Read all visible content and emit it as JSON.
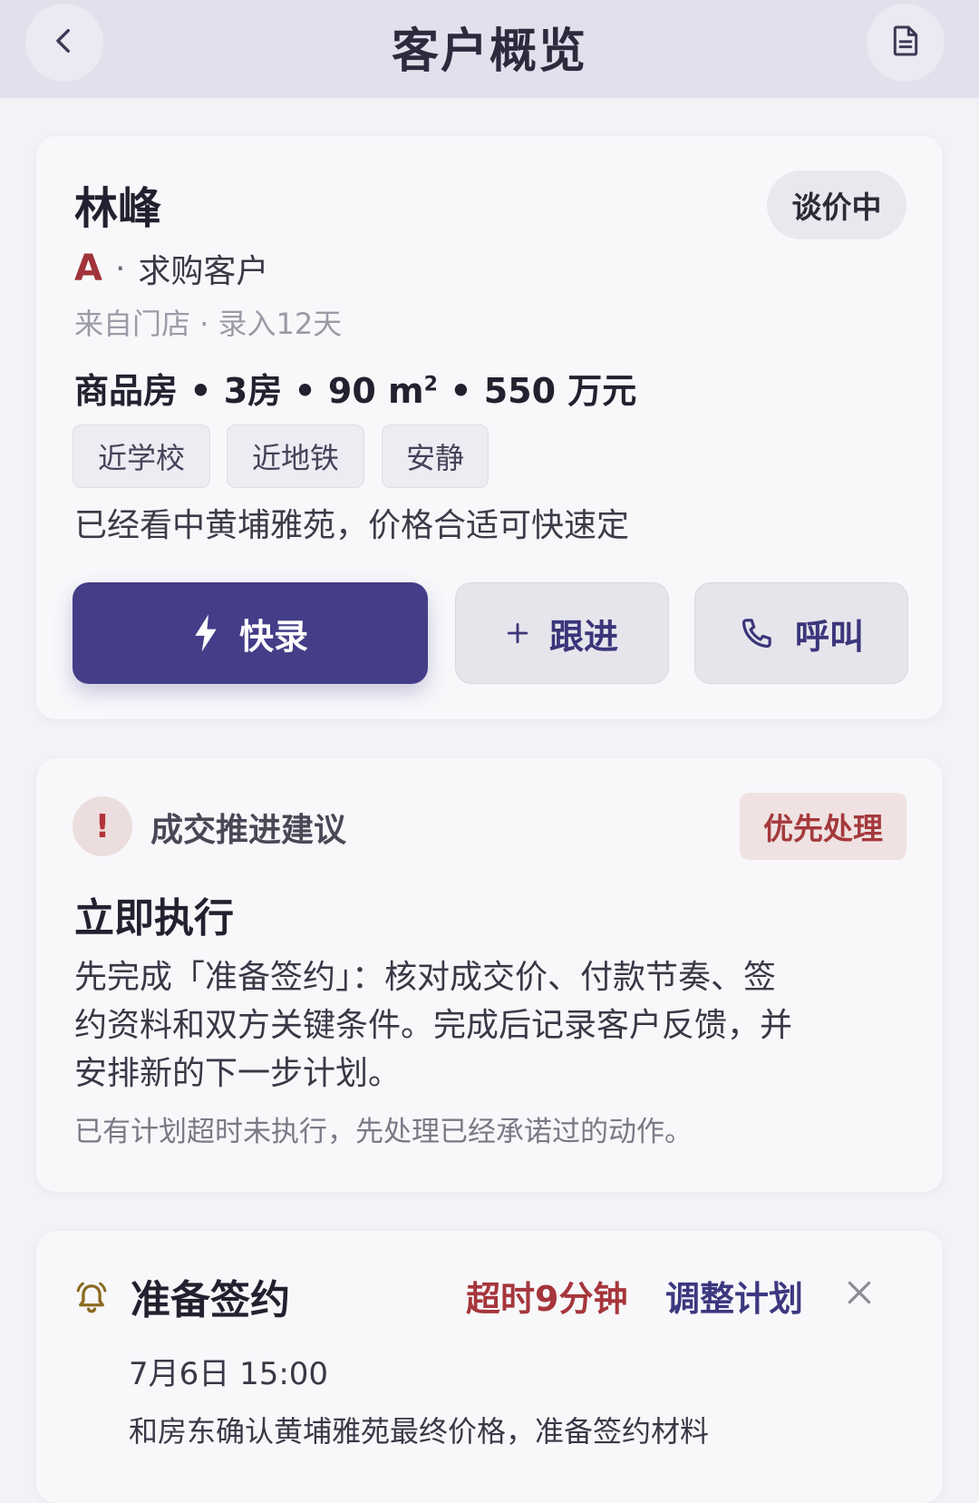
{
  "header": {
    "title": "客户概览",
    "back_icon": "chevron-left-icon",
    "doc_icon": "document-icon"
  },
  "customer": {
    "name": "林峰",
    "status": "谈价中",
    "grade": "A",
    "type": "求购客户",
    "meta": "来自门店 · 录入12天",
    "spec_main": "商品房 • 3房 • 90 m",
    "spec_sup": "2",
    "spec_tail": " • 550 万元",
    "tags": [
      "近学校",
      "近地铁",
      "安静"
    ],
    "note": "已经看中黄埔雅苑，价格合适可快速定"
  },
  "actions": {
    "quick_record": "快录",
    "follow_up": "跟进",
    "call": "呼叫"
  },
  "advice": {
    "section_title": "成交推进建议",
    "alert_mark": "!",
    "priority": "优先处理",
    "action_title": "立即执行",
    "body_line1": "先完成「准备签约」：核对成交价、付款节奏、签",
    "body_line2": "约资料和双方关键条件。完成后记录客户反馈，并",
    "body_line3": "安排新的下一步计划。",
    "hint": "已有计划超时未执行，先处理已经承诺过的动作。"
  },
  "task": {
    "title": "准备签约",
    "overdue": "超时9分钟",
    "adjust": "调整计划",
    "time": "7月6日 15:00",
    "desc": "和房东确认黄埔雅苑最终价格，准备签约材料"
  },
  "colors": {
    "primary": "#443d87",
    "danger": "#a5363b",
    "background": "#f3f2f7",
    "topbar": "#e2e0ec"
  }
}
